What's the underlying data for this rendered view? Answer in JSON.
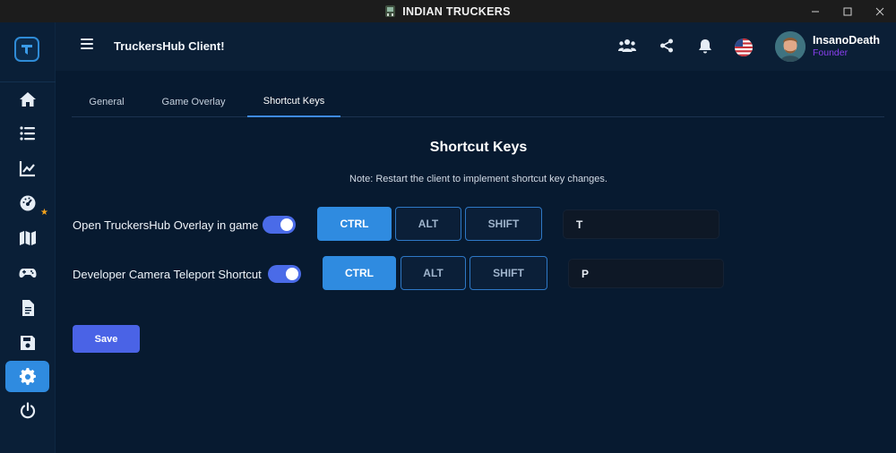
{
  "window": {
    "title": "INDIAN TRUCKERS",
    "controls": [
      "minimize-icon",
      "maximize-icon",
      "close-icon"
    ]
  },
  "sidebar": {
    "items": [
      {
        "icon": "home-icon"
      },
      {
        "icon": "list-icon"
      },
      {
        "icon": "chart-icon"
      },
      {
        "icon": "gauge-icon",
        "starred": true
      },
      {
        "icon": "map-icon"
      },
      {
        "icon": "gamepad-icon"
      },
      {
        "icon": "document-icon"
      },
      {
        "icon": "save-icon"
      },
      {
        "icon": "settings-icon",
        "active": true
      },
      {
        "icon": "power-icon"
      }
    ]
  },
  "header": {
    "title": "TruckersHub Client!",
    "user": {
      "name": "InsanoDeath",
      "role": "Founder"
    }
  },
  "tabs": [
    {
      "label": "General"
    },
    {
      "label": "Game Overlay"
    },
    {
      "label": "Shortcut Keys",
      "active": true
    }
  ],
  "content": {
    "title": "Shortcut Keys",
    "note": "Note: Restart the client to implement shortcut key changes.",
    "rows": [
      {
        "label": "Open TruckersHub Overlay in game",
        "enabled": true,
        "ctrl": "CTRL",
        "alt": "ALT",
        "shift": "SHIFT",
        "key": "T"
      },
      {
        "label": "Developer Camera Teleport Shortcut",
        "enabled": true,
        "ctrl": "CTRL",
        "alt": "ALT",
        "shift": "SHIFT",
        "key": "P"
      }
    ],
    "save_label": "Save"
  },
  "colors": {
    "accent": "#2f8be0",
    "toggle": "#4a6be8",
    "save": "#4a63e6",
    "role": "#8a3ff0",
    "background": "#071a30"
  }
}
